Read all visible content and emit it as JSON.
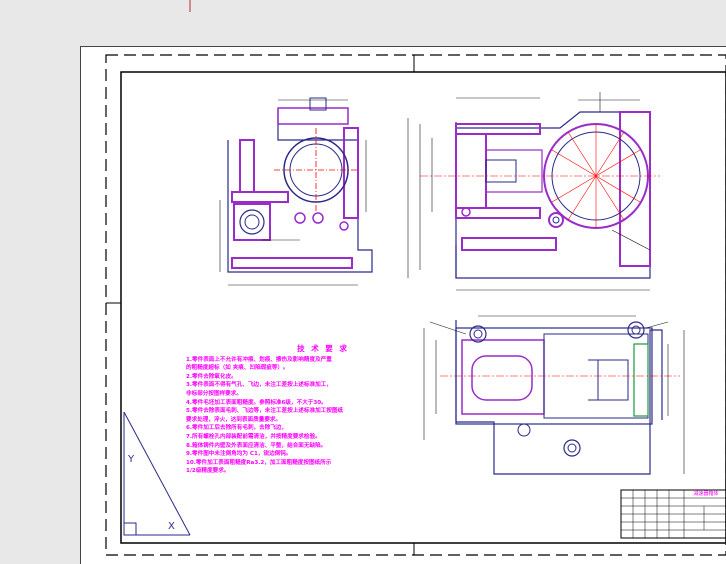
{
  "colors": {
    "background": "#e8e8e8",
    "sheet": "#ffffff",
    "outline": "#2a2a8a",
    "section": "#9a2cc9",
    "centerline": "#ff0000",
    "dimension": "#1a1a1a",
    "notes": "#ff00ff",
    "frame": "#000000"
  },
  "notes": {
    "heading": "技 术 要 求",
    "lines": [
      "1.零件表面上不允许有冲痕、划痕、擦伤及影响精度及严重",
      "的粗糙度超标（如 夹痕、凹陷瑕疵等）。",
      "2.零件去除氧化皮。",
      "3.零件表面不得有气孔、飞边，未注工差按上述标准加工，",
      "非标部分按图样要求。",
      "4.零件毛坯加工表面粗糙度。参照标准6级，不大于30。",
      "5.零件去除表面毛刺、飞边等，未注工差按上述标准加工按图纸",
      "要求处理，淬火，达到表面质量要求。",
      "6.零件加工后去除所有毛刺，去除飞边，",
      "7.所有螺栓孔内部装配前需清洁，并按精度要求检验。",
      "8.箱体铸件内壁及外表面应清洁、平整，结合面无缺陷。",
      "9.零件图中未注倒角均为 C1，锐边倒钝。",
      "10.零件加工表面粗糙度Ra3.2，加工面粗糙度按图纸所示",
      "1/2级精度要求。"
    ]
  },
  "title_block": {
    "drawing_title": "减速器箱体"
  }
}
